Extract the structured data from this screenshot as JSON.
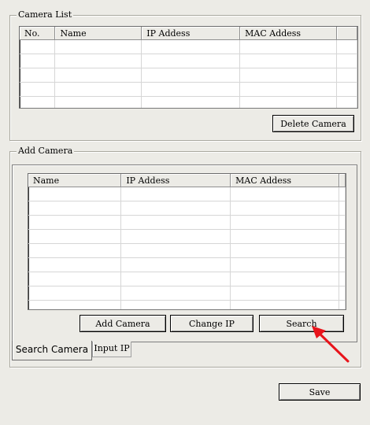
{
  "camera_list": {
    "title": "Camera List",
    "columns": [
      "No.",
      "Name",
      "IP Addess",
      "MAC Addess"
    ],
    "rows": [],
    "delete_button": "Delete Camera"
  },
  "add_camera": {
    "title": "Add Camera",
    "columns": [
      "Name",
      "IP Addess",
      "MAC Addess"
    ],
    "rows": [],
    "buttons": {
      "add": "Add Camera",
      "change_ip": "Change IP",
      "search": "Search"
    },
    "tabs": [
      {
        "label": "Search Camera",
        "active": true
      },
      {
        "label": "Input IP",
        "active": false
      }
    ]
  },
  "save_button": "Save",
  "colors": {
    "window_bg": "#ecebe6",
    "arrow_annotation": "#e8141b"
  }
}
